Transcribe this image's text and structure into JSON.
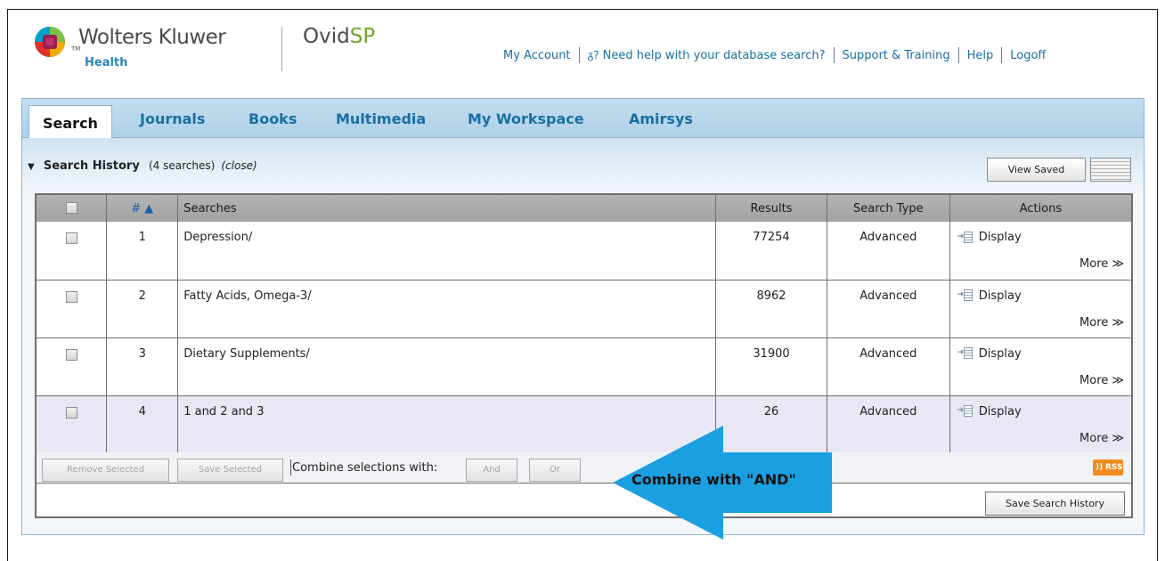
{
  "brand": {
    "company": "Wolters Kluwer",
    "division": "Health",
    "trademark": "TM",
    "product_prefix": "Ovid",
    "product_suffix": "SP"
  },
  "top_links": {
    "my_account": "My Account",
    "help_search": "Need help with your database search?",
    "support": "Support & Training",
    "help": "Help",
    "logoff": "Logoff"
  },
  "tabs": [
    {
      "label": "Search",
      "active": true
    },
    {
      "label": "Journals"
    },
    {
      "label": "Books"
    },
    {
      "label": "Multimedia"
    },
    {
      "label": "My Workspace"
    },
    {
      "label": "Amirsys"
    }
  ],
  "search_history": {
    "title": "Search History",
    "count": "(4 searches)",
    "close": "(close)",
    "view_saved": "View Saved"
  },
  "table": {
    "headers": {
      "num": "#",
      "sort_indicator": "▲",
      "searches": "Searches",
      "results": "Results",
      "search_type": "Search Type",
      "actions": "Actions"
    },
    "rows": [
      {
        "num": "1",
        "search": "Depression/",
        "results": "77254",
        "type": "Advanced",
        "display": "Display",
        "more": "More ≫"
      },
      {
        "num": "2",
        "search": "Fatty Acids, Omega-3/",
        "results": "8962",
        "type": "Advanced",
        "display": "Display",
        "more": "More ≫"
      },
      {
        "num": "3",
        "search": "Dietary Supplements/",
        "results": "31900",
        "type": "Advanced",
        "display": "Display",
        "more": "More ≫"
      },
      {
        "num": "4",
        "search": "1 and 2 and 3",
        "results": "26",
        "type": "Advanced",
        "display": "Display",
        "more": "More ≫"
      }
    ]
  },
  "footer": {
    "remove_selected": "Remove Selected",
    "save_selected": "Save Selected",
    "combine_label": "Combine selections with:",
    "and": "And",
    "or": "Or",
    "rss": "RSS",
    "save_history": "Save Search History"
  },
  "callout": {
    "text": "Combine with \"AND\"",
    "color": "#1aa0e0"
  },
  "colors": {
    "link": "#1a6fa3",
    "tab_bar": "#b8d6ec",
    "table_header": "#a8a8a8",
    "highlight_row": "#e9e7f3",
    "rss": "#f08b1d",
    "brand_green": "#73a628"
  }
}
